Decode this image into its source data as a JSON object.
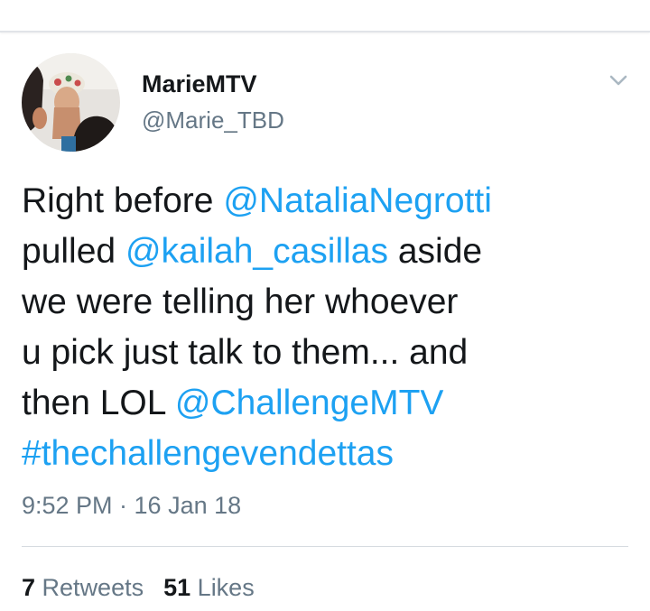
{
  "user": {
    "display_name": "MarieMTV",
    "handle": "@Marie_TBD"
  },
  "tweet": {
    "lines": [
      [
        {
          "t": "text",
          "v": "Right before "
        },
        {
          "t": "mention",
          "v": "@NataliaNegrotti"
        }
      ],
      [
        {
          "t": "text",
          "v": "pulled "
        },
        {
          "t": "mention",
          "v": "@kailah_casillas"
        },
        {
          "t": "text",
          "v": " aside"
        }
      ],
      [
        {
          "t": "text",
          "v": "we were telling her whoever"
        }
      ],
      [
        {
          "t": "text",
          "v": "u pick just talk to them... and"
        }
      ],
      [
        {
          "t": "text",
          "v": "then LOL "
        },
        {
          "t": "mention",
          "v": "@ChallengeMTV"
        }
      ],
      [
        {
          "t": "hashtag",
          "v": "#thechallengevendettas"
        }
      ]
    ],
    "timestamp": "9:52 PM · 16 Jan 18"
  },
  "stats": {
    "retweets_count": "7",
    "retweets_label": "Retweets",
    "likes_count": "51",
    "likes_label": "Likes"
  },
  "colors": {
    "link": "#1da1f2",
    "text": "#14171a",
    "secondary": "#657786"
  },
  "icons": {
    "menu": "chevron-down-icon"
  }
}
